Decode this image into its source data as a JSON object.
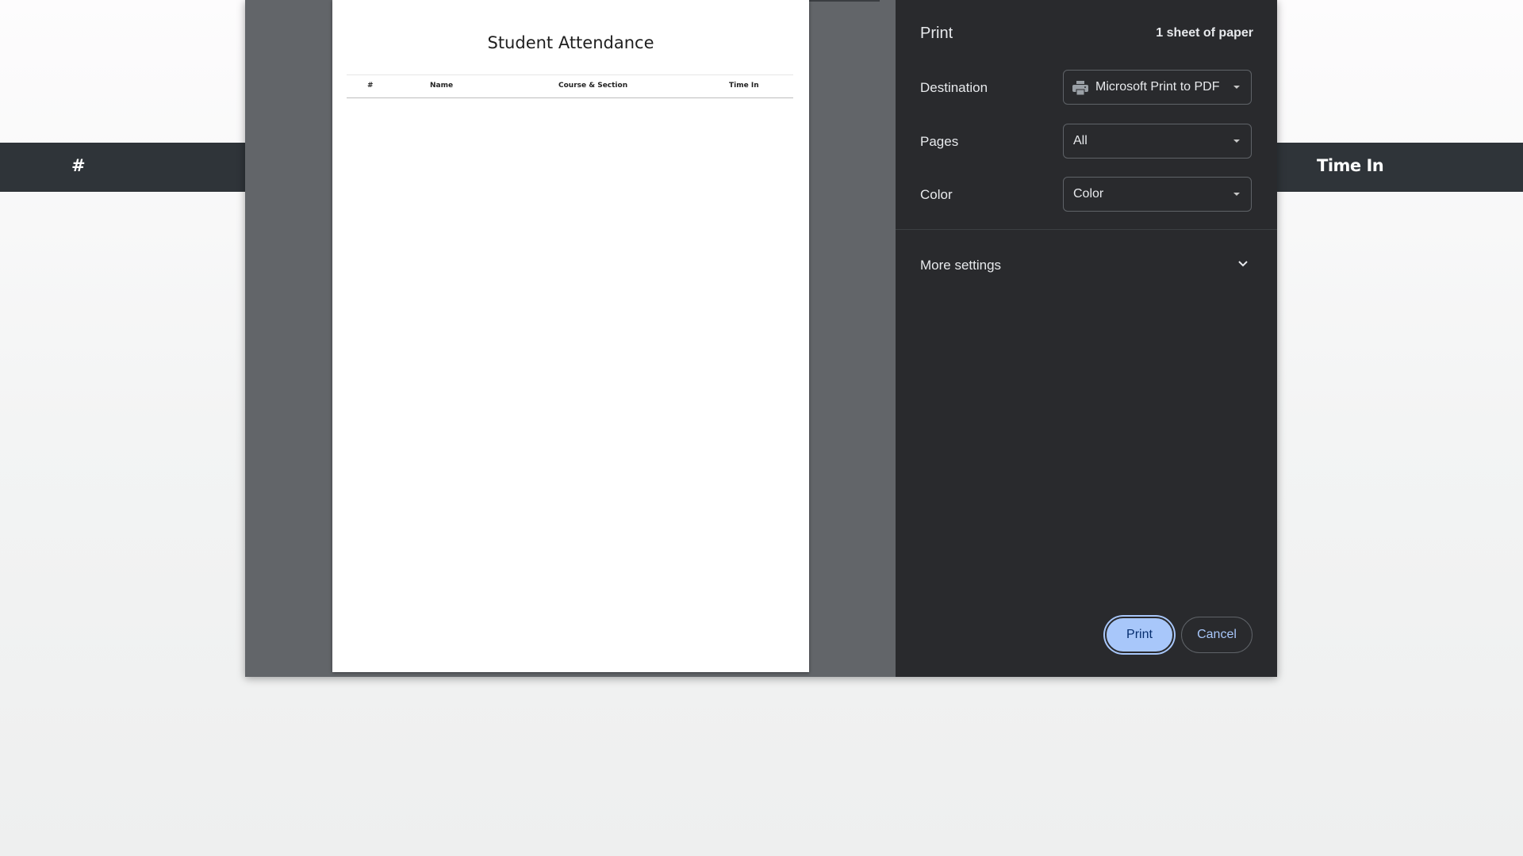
{
  "background": {
    "header_hash": "#",
    "header_time_in": "Time In"
  },
  "preview": {
    "title": "Student Attendance",
    "columns": [
      "#",
      "Name",
      "Course & Section",
      "Time In"
    ]
  },
  "print_dialog": {
    "title": "Print",
    "sheet_count": "1 sheet of paper",
    "destination": {
      "label": "Destination",
      "value": "Microsoft Print to PDF",
      "icon": "printer-icon"
    },
    "pages": {
      "label": "Pages",
      "value": "All"
    },
    "color": {
      "label": "Color",
      "value": "Color"
    },
    "more_settings": {
      "label": "More settings",
      "icon": "chevron-down-icon"
    },
    "print_button": "Print",
    "cancel_button": "Cancel"
  },
  "colors": {
    "dialog_bg": "#292a2d",
    "preview_bg": "#626569",
    "primary_button": "#a8c7fa",
    "header_strip": "#2f3439"
  }
}
